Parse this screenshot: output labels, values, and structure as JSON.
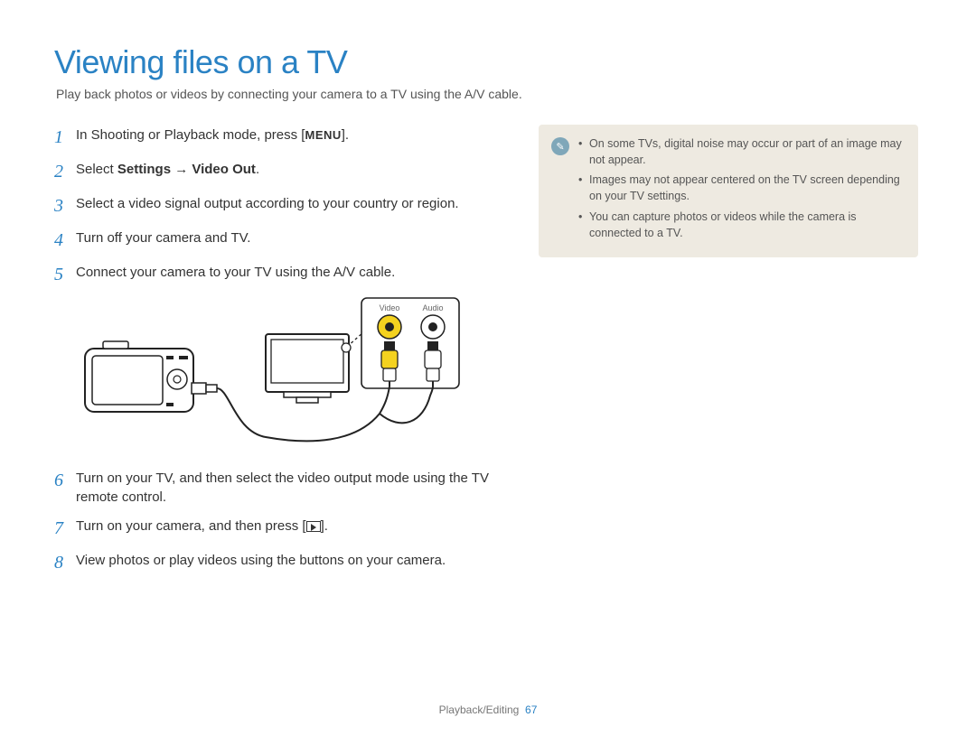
{
  "title": "Viewing files on a TV",
  "subtitle": "Play back photos or videos by connecting your camera to a TV using the A/V cable.",
  "steps": {
    "s1_pre": "In Shooting or Playback mode, press [",
    "s1_menu": "MENU",
    "s1_post": "].",
    "s2_pre": "Select ",
    "s2_bold": "Settings → Video Out",
    "s2_post": ".",
    "s3": "Select a video signal output according to your country or region.",
    "s4": "Turn off your camera and TV.",
    "s5": "Connect your camera to your TV using the A/V cable.",
    "s6": "Turn on your TV, and then select the video output mode using the TV remote control.",
    "s7_pre": "Turn on your camera, and then press [",
    "s7_post": "].",
    "s8": "View photos or play videos using the buttons on your camera."
  },
  "nums": {
    "n1": "1",
    "n2": "2",
    "n3": "3",
    "n4": "4",
    "n5": "5",
    "n6": "6",
    "n7": "7",
    "n8": "8"
  },
  "diagram": {
    "video_label": "Video",
    "audio_label": "Audio"
  },
  "notes": {
    "n1": "On some TVs, digital noise may occur or part of an image may not appear.",
    "n2": "Images may not appear centered on the TV screen depending on your TV settings.",
    "n3": "You can capture photos or videos while the camera is connected to a TV."
  },
  "note_icon_glyph": "✎",
  "footer": {
    "section": "Playback/Editing",
    "page": "67"
  }
}
